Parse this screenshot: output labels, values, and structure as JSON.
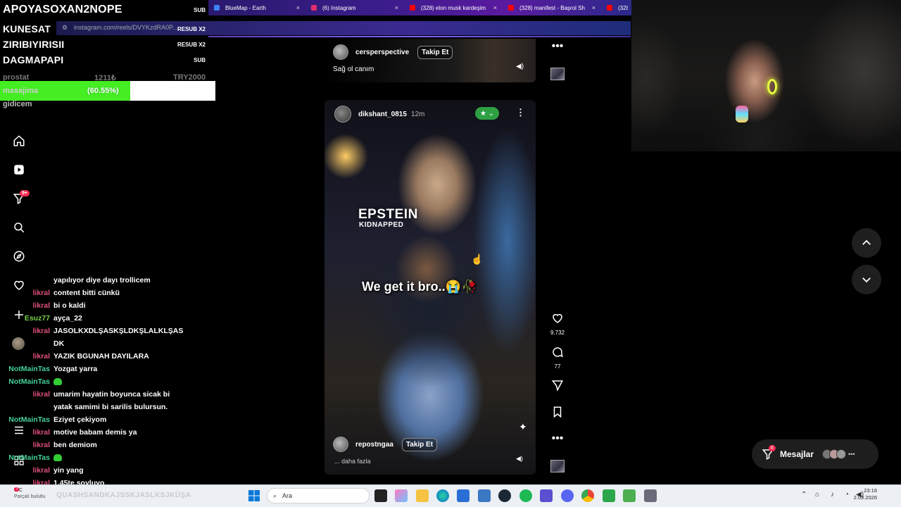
{
  "browser": {
    "tabs": [
      {
        "label": "BlueMap - Earth",
        "color": "#3b82f6"
      },
      {
        "label": "(6) Instagram",
        "color": "#e1306c"
      },
      {
        "label": "(328) elon musk kardeşim",
        "color": "#ff0000"
      },
      {
        "label": "(328) manifest - Başrol Sh",
        "color": "#ff0000"
      },
      {
        "label": "(328",
        "color": "#ff0000"
      }
    ],
    "tab_close": "×",
    "url": "instagram.com/reels/DVYKzdRA0P..."
  },
  "overlay": {
    "rows": [
      {
        "name": "APOYASOXAN2NOPE",
        "tag": "SUB"
      },
      {
        "name": "KUNESAT",
        "tag": "RESUB X2"
      },
      {
        "name": "ZIRIBIYIRISII",
        "tag": "RESUB X2"
      },
      {
        "name": "DAGMAPAPI",
        "tag": "SUB"
      }
    ],
    "stats": {
      "label": "prostat",
      "value": "1211₺",
      "target": "TRY2000"
    },
    "goal": {
      "name": "masajima",
      "percent_text": "(60.55%)",
      "fraction": 0.6055
    },
    "goal_note": "gidicem"
  },
  "nav": {
    "notif_badge": "9+",
    "icons": [
      "home-icon",
      "reels-icon",
      "filter-icon",
      "search-icon",
      "explore-icon",
      "heart-icon",
      "plus-icon",
      "profile-avatar",
      "menu-icon",
      "grid-icon"
    ]
  },
  "chat": [
    {
      "user": "",
      "text": "yapılıyor diye dayı trollicem",
      "cls": "lik"
    },
    {
      "user": "likral",
      "text": "content bitti cünkü",
      "cls": "lik"
    },
    {
      "user": "likral",
      "text": "bi o kaldi",
      "cls": "lik"
    },
    {
      "user": "Esuz77",
      "text": "ayça_22",
      "cls": "esu"
    },
    {
      "user": "likral",
      "text": "JASOLKXDLŞASKŞLDKŞLALKLŞAS DK",
      "cls": "lik"
    },
    {
      "user": "likral",
      "text": "YAZIK BGUNAH DAYILARA",
      "cls": "lik"
    },
    {
      "user": "NotMainTas",
      "text": "Yozgat yarra",
      "cls": "not"
    },
    {
      "user": "NotMainTas",
      "text": "",
      "cls": "not",
      "emoji": true
    },
    {
      "user": "likral",
      "text": "umarim hayatin boyunca sicak bi yatak samimi bi sarilis bulursun.",
      "cls": "lik"
    },
    {
      "user": "NotMainTas",
      "text": "Eziyet çekiyom",
      "cls": "not"
    },
    {
      "user": "likral",
      "text": "motive babam demis ya",
      "cls": "lik"
    },
    {
      "user": "likral",
      "text": "ben demiom",
      "cls": "lik"
    },
    {
      "user": "NotMainTas",
      "text": "",
      "cls": "not",
      "emoji": true
    },
    {
      "user": "likral",
      "text": "yin yang",
      "cls": "lik"
    },
    {
      "user": "likral",
      "text": "1.45te soyluyo",
      "cls": "lik"
    }
  ],
  "feed": {
    "top_card": {
      "user": "cersperspective",
      "follow": "Takip Et",
      "caption": "Sağ ol canım"
    },
    "main": {
      "user": "dikshant_0815",
      "time": "12m",
      "video_title": "EPSTEIN",
      "video_sub": "KIDNAPPED",
      "caption": "We get it bro..😭🥀",
      "repost_user": "repostngaa",
      "follow": "Takip Et",
      "more": "... daha fazla"
    },
    "actions": {
      "likes": "9.732",
      "comments": "77"
    }
  },
  "messages": {
    "label": "Mesajlar",
    "badge": "6"
  },
  "taskbar": {
    "weather_temp": "7°C",
    "weather_desc": "Parçalı bulutlu",
    "ticker": "QUASHSANDKAJSSKJASLKSJKÜŞA",
    "search_placeholder": "Ara",
    "notif_badge": "3",
    "time": "23:16",
    "date": "2.03.2026"
  }
}
